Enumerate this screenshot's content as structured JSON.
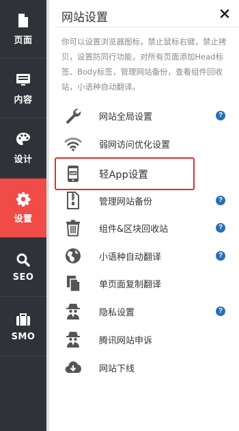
{
  "sidebar": {
    "items": [
      {
        "label": "页面",
        "icon": "file-icon"
      },
      {
        "label": "内容",
        "icon": "monitor-icon"
      },
      {
        "label": "设计",
        "icon": "palette-icon"
      },
      {
        "label": "设置",
        "icon": "gear-icon",
        "active": true
      },
      {
        "label": "SEO",
        "icon": "search-icon"
      },
      {
        "label": "SMO",
        "icon": "briefcase-icon"
      }
    ],
    "active_color": "#f04b47",
    "bg_color": "#2f3339"
  },
  "panel": {
    "title": "网站设置",
    "close_icon": "close-icon",
    "description": "你可以设置浏览器图标，禁止鼠标右键，禁止拷贝，设置防同行功能，对所有页面添加Head标签、Body标签，管理网站备份，查看组件回收站，小语种自动翻译。",
    "help_glyph": "?",
    "menu": [
      {
        "label": "网站全局设置",
        "icon": "wrench-icon",
        "help": true
      },
      {
        "label": "弱网访问优化设置",
        "icon": "wifi-icon",
        "help": false
      },
      {
        "label": "轻App设置",
        "icon": "app-phone-icon",
        "help": false,
        "highlighted": true
      },
      {
        "label": "管理网站备份",
        "icon": "zip-file-icon",
        "help": true
      },
      {
        "label": "组件&区块回收站",
        "icon": "trash-icon",
        "help": true
      },
      {
        "label": "小语种自动翻译",
        "icon": "globe-icon",
        "help": true
      },
      {
        "label": "单页面复制翻译",
        "icon": "copy-icon",
        "help": false
      },
      {
        "label": "隐私设置",
        "icon": "spy-icon",
        "help": true
      },
      {
        "label": "腾讯网站申诉",
        "icon": "spy-icon",
        "help": false
      },
      {
        "label": "网站下线",
        "icon": "cloud-download-icon",
        "help": false
      }
    ]
  }
}
